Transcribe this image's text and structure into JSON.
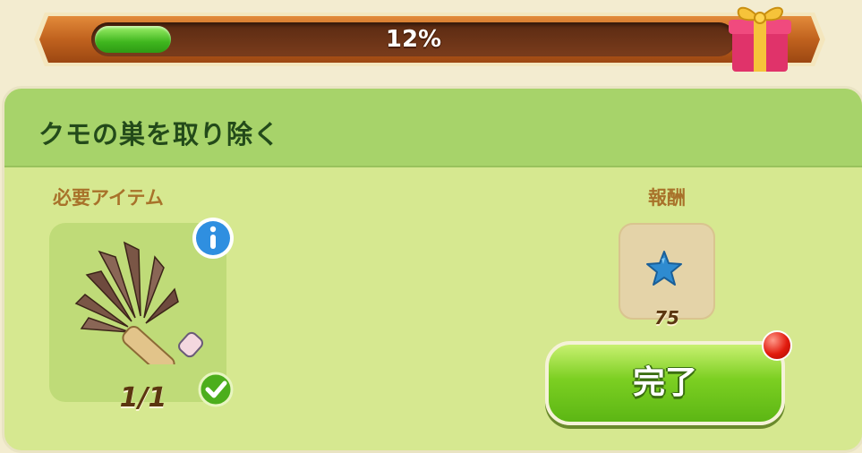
{
  "progress": {
    "percent": 12,
    "label": "12%",
    "fill_color": "#3fb61e",
    "bar_color": "#b4581c"
  },
  "gift_icon": "gift-box-icon",
  "quest": {
    "title": "クモの巣を取り除く",
    "required_label": "必要アイテム",
    "required_item": {
      "icon": "feather-duster-icon",
      "count": "1/1",
      "status_icon": "checkmark-icon",
      "info_icon": "info-icon"
    },
    "reward_label": "報酬",
    "reward": {
      "icon": "blue-star-icon",
      "amount": "75"
    },
    "complete_button": "完了",
    "notification_dot_color": "#e21b0e"
  },
  "colors": {
    "card_background": "#d6e890",
    "header_background": "#a7d36a",
    "button_green": "#7ccf22"
  }
}
